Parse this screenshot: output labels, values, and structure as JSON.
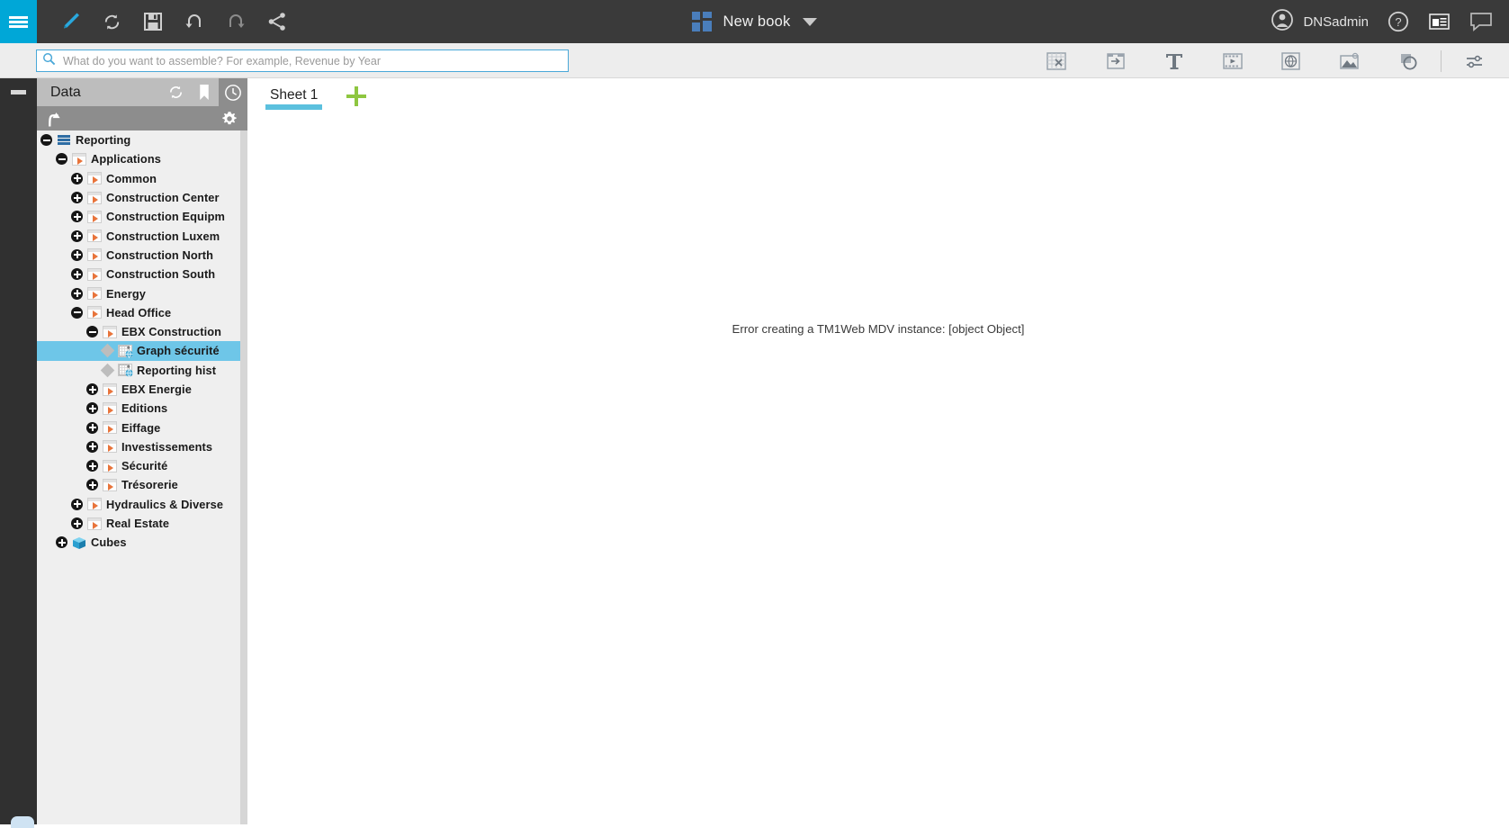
{
  "app": {
    "accent_blue": "#00a7d7",
    "topbar_bg": "#3a3a3a",
    "selection_blue": "#6ec6e8",
    "sheet_underline": "#5bc0de",
    "add_green": "#8ec640"
  },
  "topbar": {
    "menu_icon": "hamburger-icon",
    "tools": [
      {
        "name": "edit-pencil-icon",
        "label": "Edit"
      },
      {
        "name": "refresh-icon",
        "label": "Refresh"
      },
      {
        "name": "save-icon",
        "label": "Save"
      },
      {
        "name": "undo-icon",
        "label": "Undo"
      },
      {
        "name": "redo-icon",
        "label": "Redo"
      },
      {
        "name": "share-icon",
        "label": "Share"
      }
    ],
    "book_title": "New book",
    "book_icon": "book-grid-icon",
    "dropdown_icon": "chevron-down-icon",
    "user_name": "DNSadmin",
    "user_icon": "user-avatar-icon",
    "help_icon": "help-question-icon",
    "presentation_icon": "presentation-icon",
    "chat_icon": "chat-bubble-icon"
  },
  "search": {
    "placeholder": "What do you want to assemble? For example, Revenue by Year",
    "value": "",
    "icon": "search-icon"
  },
  "search_toolbar": {
    "items": [
      {
        "name": "exploration-grid-icon",
        "label": "Exploration"
      },
      {
        "name": "import-folder-icon",
        "label": "Import"
      },
      {
        "name": "text-widget-icon",
        "label": "Text"
      },
      {
        "name": "media-widget-icon",
        "label": "Media"
      },
      {
        "name": "web-page-icon",
        "label": "Web page"
      },
      {
        "name": "image-widget-icon",
        "label": "Image"
      },
      {
        "name": "shape-widget-icon",
        "label": "Shape"
      },
      {
        "name": "settings-sliders-icon",
        "label": "Settings"
      }
    ]
  },
  "left_rail": {
    "collapse_icon": "collapse-panel-icon"
  },
  "data_panel": {
    "title": "Data",
    "header_icons": [
      {
        "name": "refresh-icon",
        "label": "Refresh"
      },
      {
        "name": "bookmark-icon",
        "label": "Bookmarks"
      },
      {
        "name": "recent-clock-icon",
        "label": "Recent"
      }
    ],
    "sub_icons": [
      {
        "name": "go-up-icon",
        "label": "Up one level"
      },
      {
        "name": "gear-icon",
        "label": "Options"
      }
    ],
    "tree": [
      {
        "label": "Reporting",
        "depth": 0,
        "twisty": "minus",
        "icon": "server",
        "selected": false
      },
      {
        "label": "Applications",
        "depth": 1,
        "twisty": "minus",
        "icon": "app",
        "selected": false
      },
      {
        "label": "Common",
        "depth": 2,
        "twisty": "plus",
        "icon": "app",
        "selected": false
      },
      {
        "label": "Construction Center",
        "depth": 2,
        "twisty": "plus",
        "icon": "app",
        "selected": false
      },
      {
        "label": "Construction Equipm",
        "depth": 2,
        "twisty": "plus",
        "icon": "app",
        "selected": false
      },
      {
        "label": "Construction Luxem",
        "depth": 2,
        "twisty": "plus",
        "icon": "app",
        "selected": false
      },
      {
        "label": "Construction North",
        "depth": 2,
        "twisty": "plus",
        "icon": "app",
        "selected": false
      },
      {
        "label": "Construction South",
        "depth": 2,
        "twisty": "plus",
        "icon": "app",
        "selected": false
      },
      {
        "label": "Energy",
        "depth": 2,
        "twisty": "plus",
        "icon": "app",
        "selected": false
      },
      {
        "label": "Head Office",
        "depth": 2,
        "twisty": "minus",
        "icon": "app",
        "selected": false
      },
      {
        "label": "EBX Construction",
        "depth": 3,
        "twisty": "minus",
        "icon": "app",
        "selected": false
      },
      {
        "label": "Graph sécurité",
        "depth": 4,
        "twisty": "diamond",
        "icon": "view",
        "selected": true
      },
      {
        "label": "Reporting hist",
        "depth": 4,
        "twisty": "diamond",
        "icon": "view",
        "selected": false
      },
      {
        "label": "EBX Energie",
        "depth": 3,
        "twisty": "plus",
        "icon": "app",
        "selected": false
      },
      {
        "label": "Editions",
        "depth": 3,
        "twisty": "plus",
        "icon": "app",
        "selected": false
      },
      {
        "label": "Eiffage",
        "depth": 3,
        "twisty": "plus",
        "icon": "app",
        "selected": false
      },
      {
        "label": "Investissements",
        "depth": 3,
        "twisty": "plus",
        "icon": "app",
        "selected": false
      },
      {
        "label": "Sécurité",
        "depth": 3,
        "twisty": "plus",
        "icon": "app",
        "selected": false
      },
      {
        "label": "Trésorerie",
        "depth": 3,
        "twisty": "plus",
        "icon": "app",
        "selected": false
      },
      {
        "label": "Hydraulics & Diverse",
        "depth": 2,
        "twisty": "plus",
        "icon": "app",
        "selected": false
      },
      {
        "label": "Real Estate",
        "depth": 2,
        "twisty": "plus",
        "icon": "app",
        "selected": false
      },
      {
        "label": "Cubes",
        "depth": 1,
        "twisty": "plus",
        "icon": "cube",
        "selected": false
      }
    ]
  },
  "main": {
    "sheets": [
      {
        "label": "Sheet 1",
        "active": true
      }
    ],
    "add_sheet_icon": "add-sheet-plus-icon",
    "error_message": "Error creating a TM1Web MDV instance: [object Object]"
  }
}
